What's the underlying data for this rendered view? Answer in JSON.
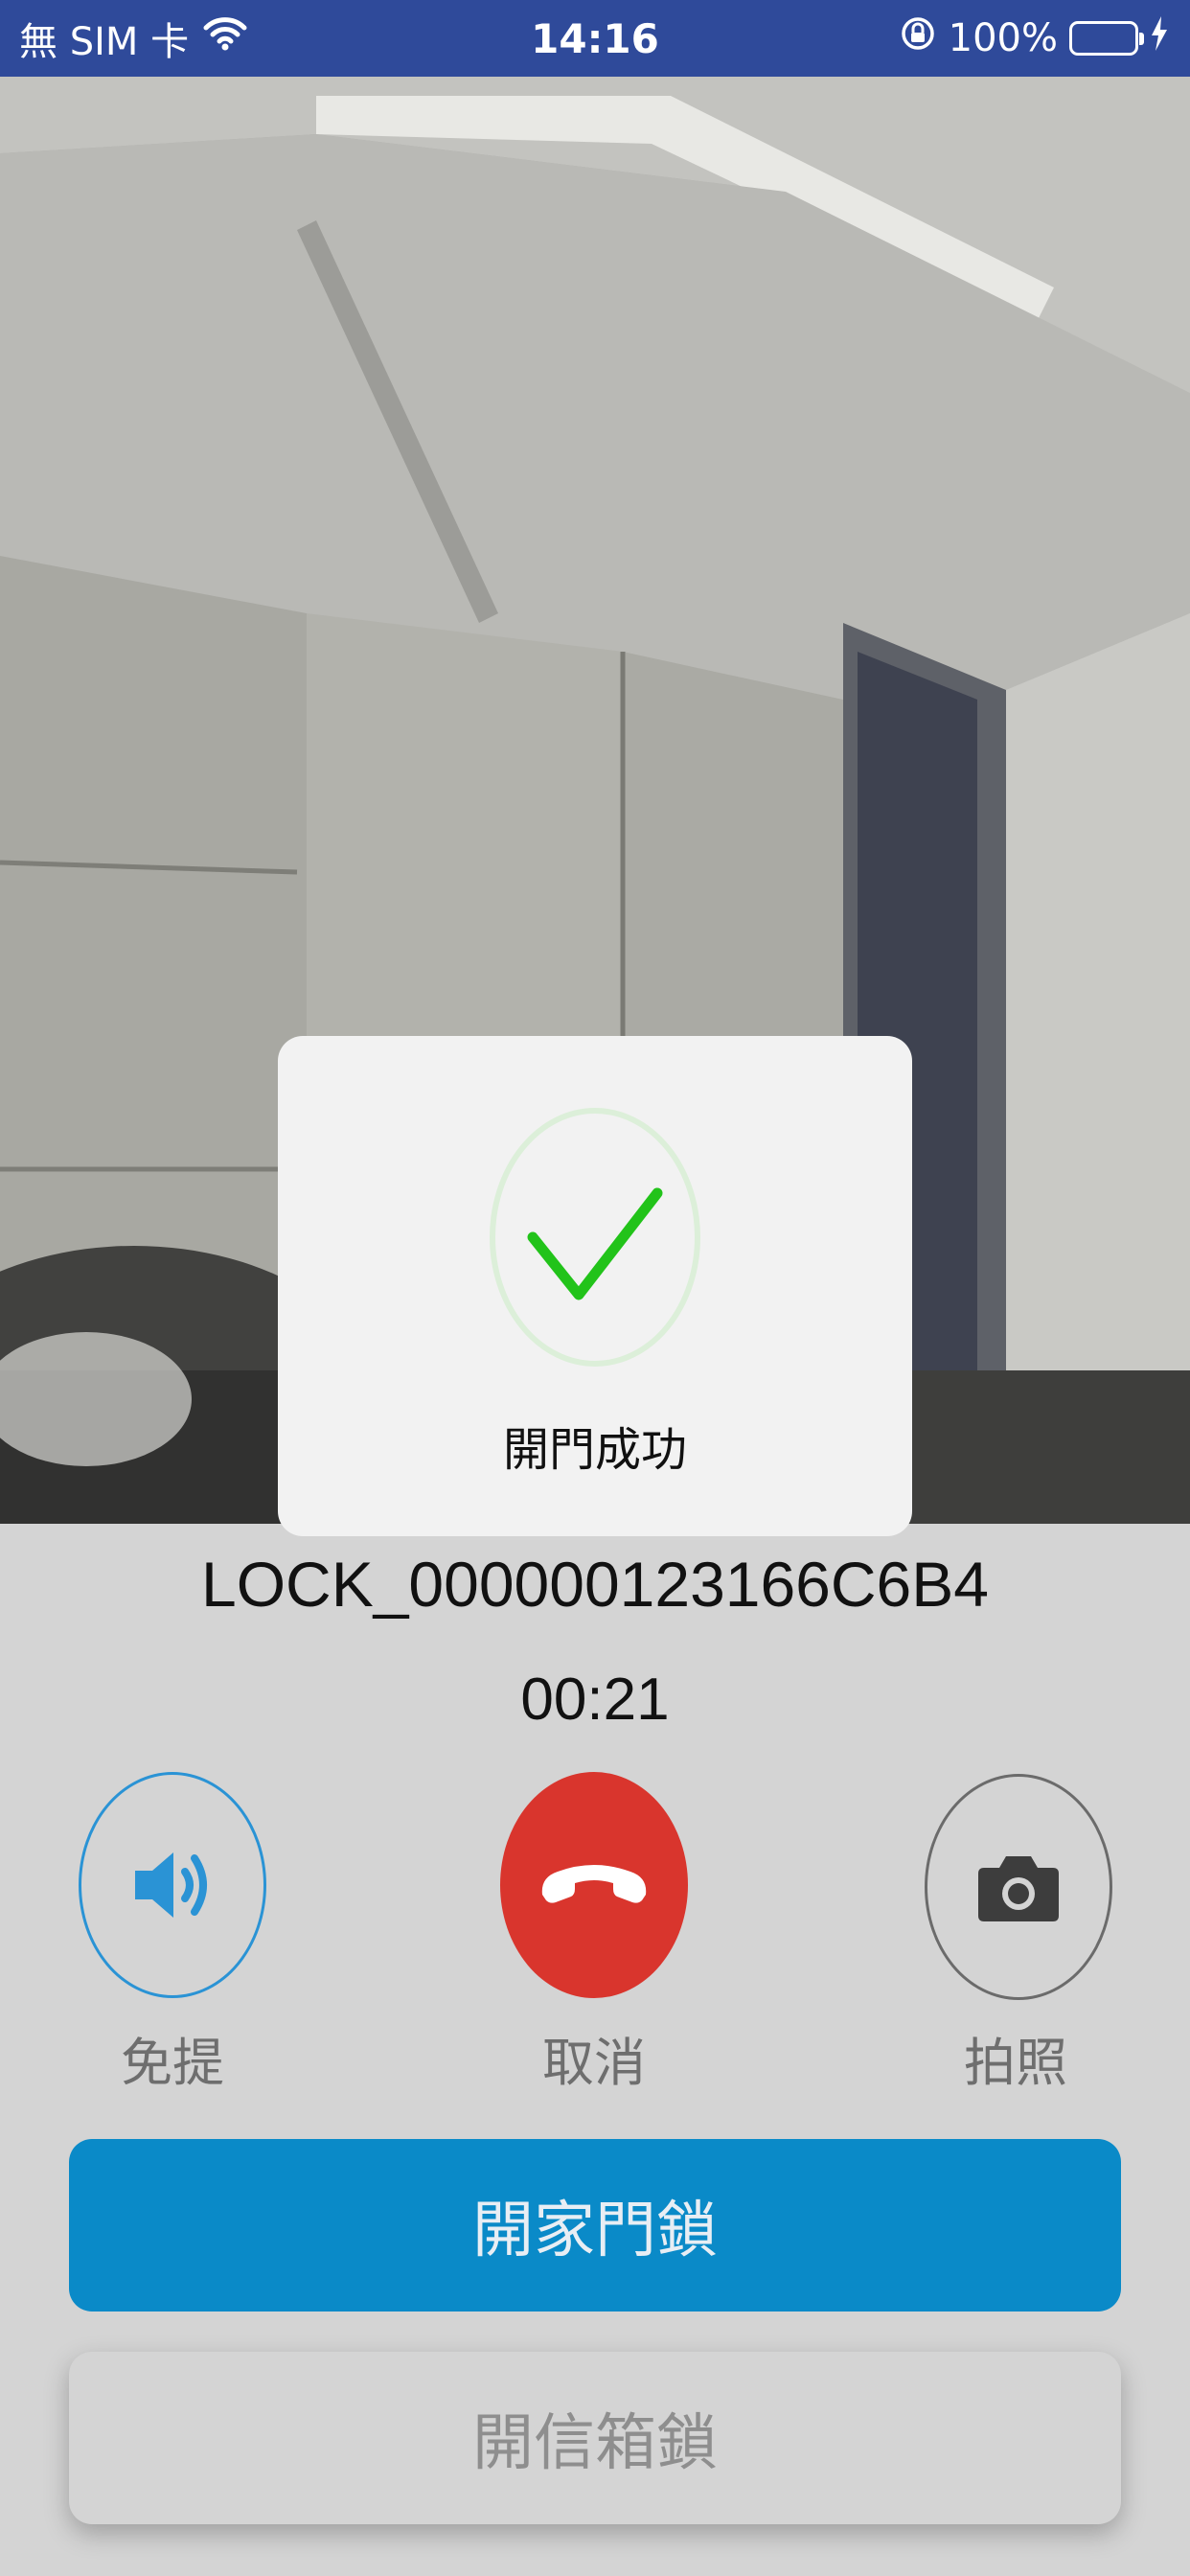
{
  "status_bar": {
    "carrier": "無 SIM 卡",
    "time": "14:16",
    "battery_percent": "100%",
    "icons": [
      "wifi-icon",
      "orientation-lock-icon",
      "battery-icon",
      "charging-icon"
    ]
  },
  "toast": {
    "message": "開門成功",
    "icon": "checkmark-icon",
    "check_color": "#22c31a"
  },
  "call": {
    "device_name": "LOCK_000000123166C6B4",
    "duration": "00:21"
  },
  "actions": {
    "speaker_label": "免提",
    "cancel_label": "取消",
    "photo_label": "拍照"
  },
  "buttons": {
    "open_door": "開家門鎖",
    "open_mailbox": "開信箱鎖"
  },
  "colors": {
    "status_bar": "#2f4a9a",
    "speaker_accent": "#2a93d5",
    "hangup": "#d9352d",
    "primary_button": "#0a8ac8"
  }
}
